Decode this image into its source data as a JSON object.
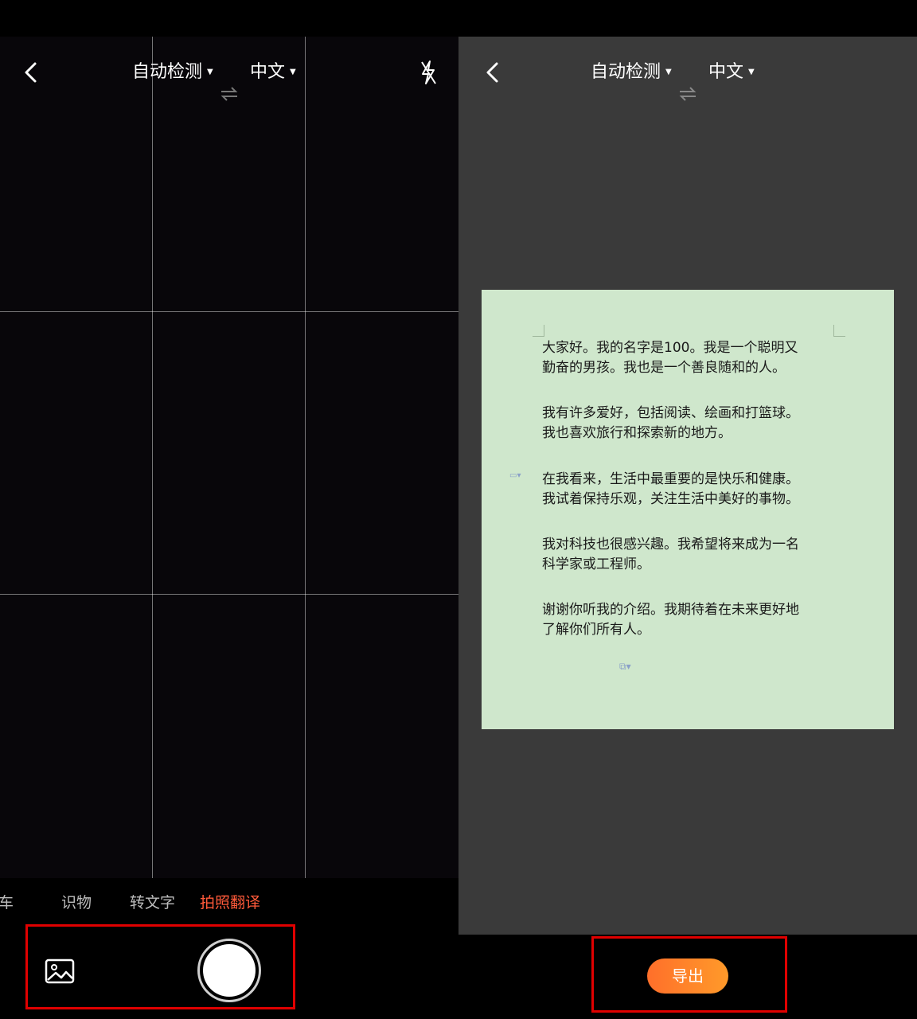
{
  "camera": {
    "source_lang": "自动检测",
    "target_lang": "中文",
    "modes": [
      "车",
      "识物",
      "转文字",
      "拍照翻译"
    ],
    "active_mode": "拍照翻译"
  },
  "result": {
    "source_lang": "自动检测",
    "target_lang": "中文",
    "paragraphs": [
      [
        "大家好。我的名字是100。我是一个聪明又",
        "勤奋的男孩。我也是一个善良随和的人。"
      ],
      [
        "我有许多爱好，包括阅读、绘画和打篮球。",
        "我也喜欢旅行和探索新的地方。"
      ],
      [
        "在我看来，生活中最重要的是快乐和健康。",
        "我试着保持乐观，关注生活中美好的事物。"
      ],
      [
        "我对科技也很感兴趣。我希望将来成为一名",
        "科学家或工程师。"
      ],
      [
        "谢谢你听我的介绍。我期待着在未来更好地",
        "了解你们所有人。"
      ]
    ],
    "export_label": "导出"
  },
  "colors": {
    "accent": "#ff5a3a",
    "highlight_box": "#e00000",
    "doc_background": "#cfe7cc"
  }
}
